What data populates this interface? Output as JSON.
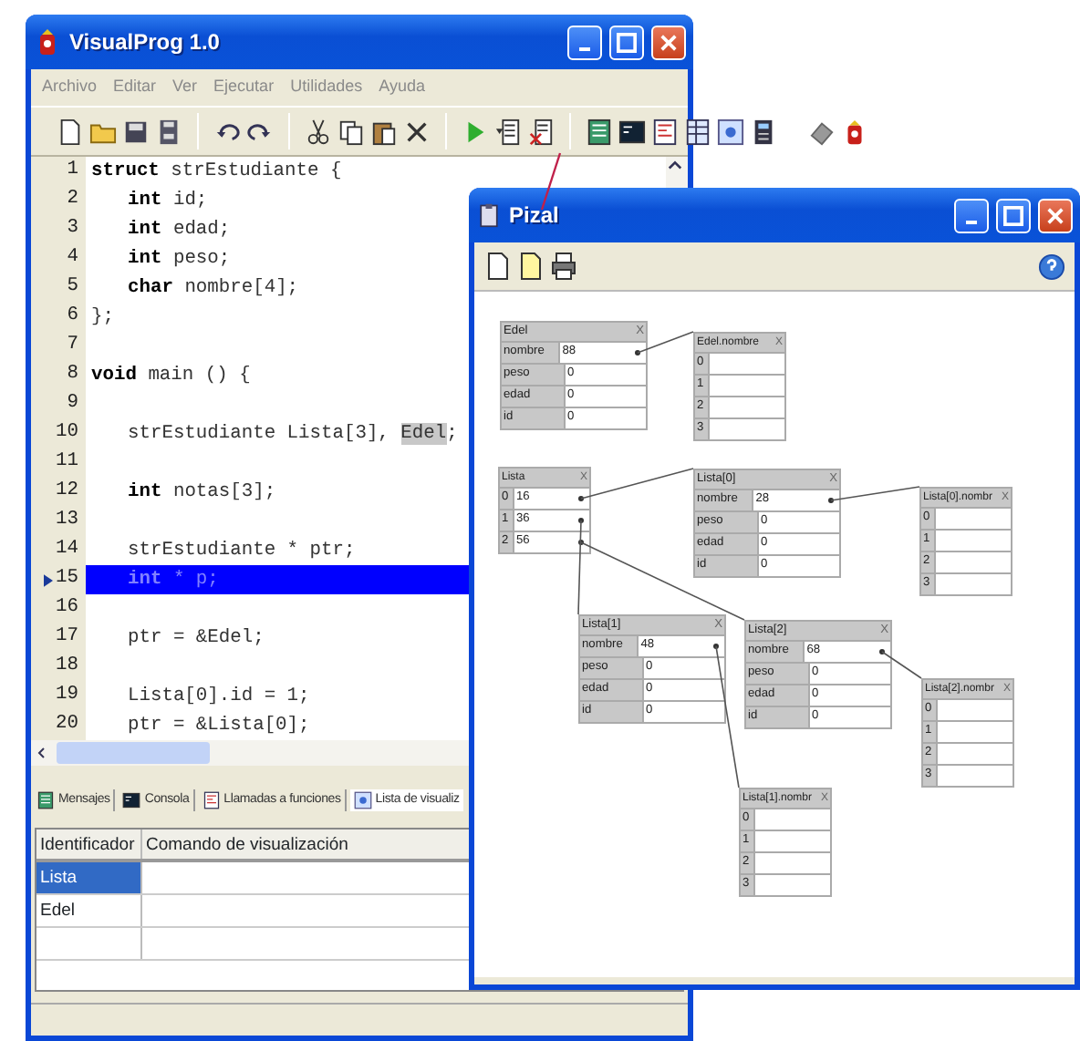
{
  "main_window": {
    "title": "VisualProg 1.0",
    "menu": [
      "Archivo",
      "Editar",
      "Ver",
      "Ejecutar",
      "Utilidades",
      "Ayuda"
    ],
    "code_lines": [
      {
        "number": "1",
        "indented": false,
        "current": false,
        "segments": [
          {
            "text": "struct",
            "kind": "keyword"
          },
          {
            "text": " strEstudiante {",
            "kind": "plain"
          }
        ]
      },
      {
        "number": "2",
        "indented": true,
        "current": false,
        "segments": [
          {
            "text": "int",
            "kind": "keyword"
          },
          {
            "text": " id;",
            "kind": "plain"
          }
        ]
      },
      {
        "number": "3",
        "indented": true,
        "current": false,
        "segments": [
          {
            "text": "int",
            "kind": "keyword"
          },
          {
            "text": " edad;",
            "kind": "plain"
          }
        ]
      },
      {
        "number": "4",
        "indented": true,
        "current": false,
        "segments": [
          {
            "text": "int",
            "kind": "keyword"
          },
          {
            "text": " peso;",
            "kind": "plain"
          }
        ]
      },
      {
        "number": "5",
        "indented": true,
        "current": false,
        "segments": [
          {
            "text": "char",
            "kind": "keyword"
          },
          {
            "text": " nombre[4];",
            "kind": "plain"
          }
        ]
      },
      {
        "number": "6",
        "indented": false,
        "current": false,
        "segments": [
          {
            "text": "};",
            "kind": "plain"
          }
        ]
      },
      {
        "number": "7",
        "current": false
      },
      {
        "number": "8",
        "indented": false,
        "current": false,
        "segments": [
          {
            "text": "void",
            "kind": "keyword"
          },
          {
            "text": " main () {",
            "kind": "plain"
          }
        ]
      },
      {
        "number": "9",
        "current": false
      },
      {
        "number": "10",
        "indented": true,
        "current": false,
        "segments": [
          {
            "text": "strEstudiante Lista[3], ",
            "kind": "plain"
          },
          {
            "text": "Edel",
            "kind": "highlight"
          },
          {
            "text": ";",
            "kind": "plain"
          }
        ]
      },
      {
        "number": "11",
        "current": false
      },
      {
        "number": "12",
        "indented": true,
        "current": false,
        "segments": [
          {
            "text": "int",
            "kind": "keyword"
          },
          {
            "text": " notas[3];",
            "kind": "plain"
          }
        ]
      },
      {
        "number": "13",
        "current": false
      },
      {
        "number": "14",
        "indented": true,
        "current": false,
        "segments": [
          {
            "text": "strEstudiante * ptr;",
            "kind": "plain"
          }
        ]
      },
      {
        "number": "15",
        "indented": true,
        "current": true,
        "segments": [
          {
            "text": "int",
            "kind": "keyword"
          },
          {
            "text": " * p;",
            "kind": "plain"
          }
        ]
      },
      {
        "number": "16",
        "current": false
      },
      {
        "number": "17",
        "indented": true,
        "current": false,
        "segments": [
          {
            "text": "ptr = &Edel;",
            "kind": "plain"
          }
        ]
      },
      {
        "number": "18",
        "current": false
      },
      {
        "number": "19",
        "indented": true,
        "current": false,
        "segments": [
          {
            "text": "Lista[0].id = 1;",
            "kind": "plain"
          }
        ]
      },
      {
        "number": "20",
        "indented": true,
        "current": false,
        "segments": [
          {
            "text": "ptr = &Lista[0];",
            "kind": "plain"
          }
        ]
      }
    ],
    "panel_tabs": [
      {
        "label": "Mensajes",
        "selected": false
      },
      {
        "label": "Consola",
        "selected": false
      },
      {
        "label": "Llamadas a funciones",
        "selected": false
      },
      {
        "label": "Lista de visualiz",
        "selected": true
      }
    ],
    "watch_table": {
      "columns": [
        "Identificador",
        "Comando de visualización"
      ],
      "rows": [
        {
          "identifier": "Lista",
          "selected": true
        },
        {
          "identifier": "Edel",
          "selected": false
        }
      ]
    }
  },
  "diagram_window": {
    "title": "Pizal",
    "nodes": [
      {
        "title": "Edel",
        "close": "X",
        "kind": "struct",
        "rows": [
          {
            "label": "nombre",
            "value": "88",
            "pointer": true
          },
          {
            "label": "peso",
            "value": "0",
            "pointer": false
          },
          {
            "label": "edad",
            "value": "0",
            "pointer": false
          },
          {
            "label": "id",
            "value": "0",
            "pointer": false
          }
        ]
      },
      {
        "title": "Edel.nombre",
        "close": "X",
        "kind": "array",
        "rows": [
          {
            "label": "0",
            "pointer": false
          },
          {
            "label": "1",
            "pointer": false
          },
          {
            "label": "2",
            "pointer": false
          },
          {
            "label": "3",
            "pointer": false
          }
        ]
      },
      {
        "title": "Lista",
        "close": "X",
        "kind": "array",
        "rows": [
          {
            "label": "0",
            "value": "16",
            "pointer": true
          },
          {
            "label": "1",
            "value": "36",
            "pointer": true
          },
          {
            "label": "2",
            "value": "56",
            "pointer": true
          }
        ]
      },
      {
        "title": "Lista[0]",
        "close": "X",
        "kind": "struct",
        "rows": [
          {
            "label": "nombre",
            "value": "28",
            "pointer": true
          },
          {
            "label": "peso",
            "value": "0",
            "pointer": false
          },
          {
            "label": "edad",
            "value": "0",
            "pointer": false
          },
          {
            "label": "id",
            "value": "0",
            "pointer": false
          }
        ]
      },
      {
        "title": "Lista[0].nombr",
        "close": "X",
        "kind": "array",
        "rows": [
          {
            "label": "0",
            "pointer": false
          },
          {
            "label": "1",
            "pointer": false
          },
          {
            "label": "2",
            "pointer": false
          },
          {
            "label": "3",
            "pointer": false
          }
        ]
      },
      {
        "title": "Lista[1]",
        "close": "X",
        "kind": "struct",
        "rows": [
          {
            "label": "nombre",
            "value": "48",
            "pointer": true
          },
          {
            "label": "peso",
            "value": "0",
            "pointer": false
          },
          {
            "label": "edad",
            "value": "0",
            "pointer": false
          },
          {
            "label": "id",
            "value": "0",
            "pointer": false
          }
        ]
      },
      {
        "title": "Lista[2]",
        "close": "X",
        "kind": "struct",
        "rows": [
          {
            "label": "nombre",
            "value": "68",
            "pointer": true
          },
          {
            "label": "peso",
            "value": "0",
            "pointer": false
          },
          {
            "label": "edad",
            "value": "0",
            "pointer": false
          },
          {
            "label": "id",
            "value": "0",
            "pointer": false
          }
        ]
      },
      {
        "title": "Lista[2].nombr",
        "close": "X",
        "kind": "array",
        "rows": [
          {
            "label": "0",
            "pointer": false
          },
          {
            "label": "1",
            "pointer": false
          },
          {
            "label": "2",
            "pointer": false
          },
          {
            "label": "3",
            "pointer": false
          }
        ]
      },
      {
        "title": "Lista[1].nombr",
        "close": "X",
        "kind": "array",
        "rows": [
          {
            "label": "0",
            "pointer": false
          },
          {
            "label": "1",
            "pointer": false
          },
          {
            "label": "2",
            "pointer": false
          },
          {
            "label": "3",
            "pointer": false
          }
        ]
      }
    ]
  }
}
